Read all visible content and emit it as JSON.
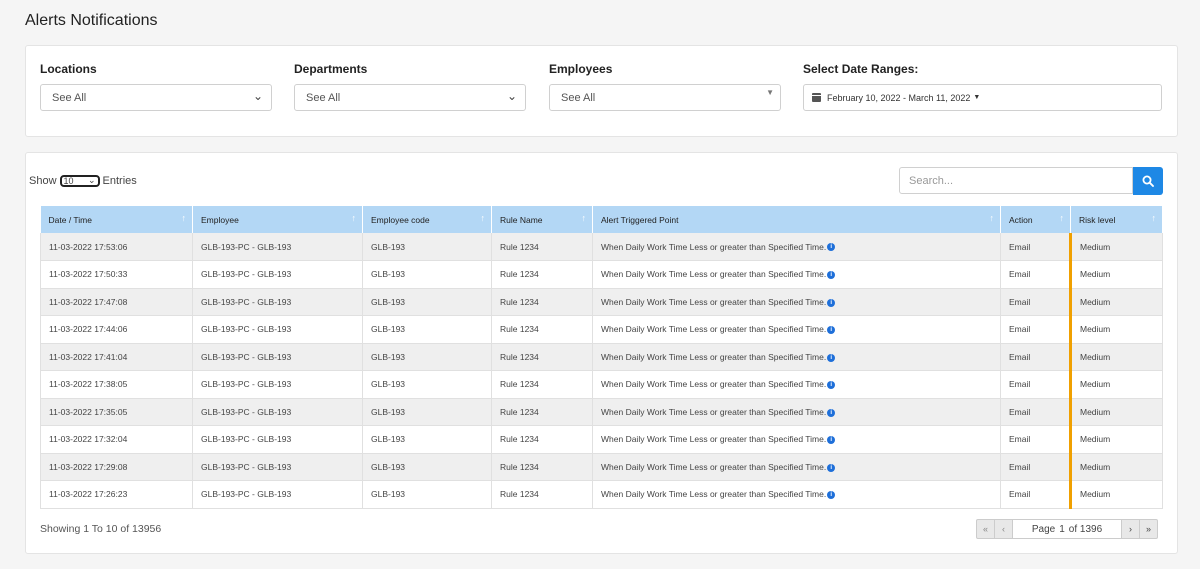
{
  "page_title": "Alerts Notifications",
  "filters": {
    "locations": {
      "label": "Locations",
      "value": "See All"
    },
    "departments": {
      "label": "Departments",
      "value": "See All"
    },
    "employees": {
      "label": "Employees",
      "value": "See All"
    },
    "date_range": {
      "label": "Select Date Ranges:",
      "value": "February 10, 2022 - March 11, 2022"
    }
  },
  "table_controls": {
    "show_label": "Show",
    "entries_value": "10",
    "entries_label": "Entries",
    "search_placeholder": "Search..."
  },
  "columns": [
    "Date / Time",
    "Employee",
    "Employee code",
    "Rule Name",
    "Alert Triggered Point",
    "Action",
    "Risk level"
  ],
  "rows": [
    {
      "datetime": "11-03-2022 17:53:06",
      "employee": "GLB-193-PC - GLB-193",
      "code": "GLB-193",
      "rule": "Rule 1234",
      "trigger": "When Daily Work Time Less or greater than Specified Time.",
      "action": "Email",
      "risk": "Medium"
    },
    {
      "datetime": "11-03-2022 17:50:33",
      "employee": "GLB-193-PC - GLB-193",
      "code": "GLB-193",
      "rule": "Rule 1234",
      "trigger": "When Daily Work Time Less or greater than Specified Time.",
      "action": "Email",
      "risk": "Medium"
    },
    {
      "datetime": "11-03-2022 17:47:08",
      "employee": "GLB-193-PC - GLB-193",
      "code": "GLB-193",
      "rule": "Rule 1234",
      "trigger": "When Daily Work Time Less or greater than Specified Time.",
      "action": "Email",
      "risk": "Medium"
    },
    {
      "datetime": "11-03-2022 17:44:06",
      "employee": "GLB-193-PC - GLB-193",
      "code": "GLB-193",
      "rule": "Rule 1234",
      "trigger": "When Daily Work Time Less or greater than Specified Time.",
      "action": "Email",
      "risk": "Medium"
    },
    {
      "datetime": "11-03-2022 17:41:04",
      "employee": "GLB-193-PC - GLB-193",
      "code": "GLB-193",
      "rule": "Rule 1234",
      "trigger": "When Daily Work Time Less or greater than Specified Time.",
      "action": "Email",
      "risk": "Medium"
    },
    {
      "datetime": "11-03-2022 17:38:05",
      "employee": "GLB-193-PC - GLB-193",
      "code": "GLB-193",
      "rule": "Rule 1234",
      "trigger": "When Daily Work Time Less or greater than Specified Time.",
      "action": "Email",
      "risk": "Medium"
    },
    {
      "datetime": "11-03-2022 17:35:05",
      "employee": "GLB-193-PC - GLB-193",
      "code": "GLB-193",
      "rule": "Rule 1234",
      "trigger": "When Daily Work Time Less or greater than Specified Time.",
      "action": "Email",
      "risk": "Medium"
    },
    {
      "datetime": "11-03-2022 17:32:04",
      "employee": "GLB-193-PC - GLB-193",
      "code": "GLB-193",
      "rule": "Rule 1234",
      "trigger": "When Daily Work Time Less or greater than Specified Time.",
      "action": "Email",
      "risk": "Medium"
    },
    {
      "datetime": "11-03-2022 17:29:08",
      "employee": "GLB-193-PC - GLB-193",
      "code": "GLB-193",
      "rule": "Rule 1234",
      "trigger": "When Daily Work Time Less or greater than Specified Time.",
      "action": "Email",
      "risk": "Medium"
    },
    {
      "datetime": "11-03-2022 17:26:23",
      "employee": "GLB-193-PC - GLB-193",
      "code": "GLB-193",
      "rule": "Rule 1234",
      "trigger": "When Daily Work Time Less or greater than Specified Time.",
      "action": "Email",
      "risk": "Medium"
    }
  ],
  "footer": {
    "showing": "Showing 1 To 10 of 13956",
    "page_label": "Page",
    "page_current": "1",
    "page_of": "of 1396"
  },
  "colors": {
    "accent": "#1e88e5",
    "header_bg": "#b3d7f5",
    "risk_bar": "#f0a000"
  }
}
